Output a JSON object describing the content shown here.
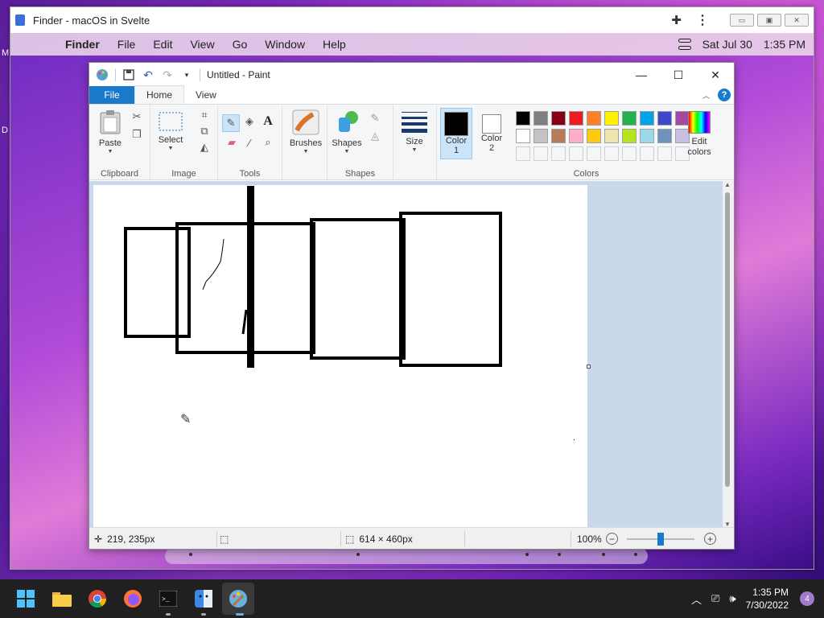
{
  "browser": {
    "tab_title": "Finder - macOS in Svelte",
    "extensions_icon": "puzzle-icon",
    "menu_icon": "kebab-icon"
  },
  "mac": {
    "apple_icon": "apple-logo-icon",
    "app_name": "Finder",
    "menus": [
      "File",
      "Edit",
      "View",
      "Go",
      "Window",
      "Help"
    ],
    "date": "Sat Jul 30",
    "time": "1:35 PM"
  },
  "paint": {
    "title": "Untitled - Paint",
    "tabs": {
      "file": "File",
      "home": "Home",
      "view": "View"
    },
    "groups": {
      "clipboard": "Clipboard",
      "image": "Image",
      "tools": "Tools",
      "shapes": "Shapes",
      "colors": "Colors"
    },
    "buttons": {
      "paste": "Paste",
      "select": "Select",
      "brushes": "Brushes",
      "shapes": "Shapes",
      "size": "Size",
      "color1": "Color\n1",
      "color1_a": "Color",
      "color1_b": "1",
      "color2_a": "Color",
      "color2_b": "2",
      "edit_colors_a": "Edit",
      "edit_colors_b": "colors"
    },
    "palette_row1": [
      "#000000",
      "#7f7f7f",
      "#880015",
      "#ed1c24",
      "#ff7f27",
      "#fff200",
      "#22b14c",
      "#00a2e8",
      "#3f48cc",
      "#a349a4"
    ],
    "palette_row2": [
      "#ffffff",
      "#c3c3c3",
      "#b97a57",
      "#ffaec9",
      "#ffc90e",
      "#efe4b0",
      "#b5e61d",
      "#99d9ea",
      "#7092be",
      "#c8bfe7"
    ],
    "color1_value": "#000000",
    "color2_value": "#ffffff",
    "status": {
      "cursor_pos": "219, 235px",
      "canvas_size": "614 × 460px",
      "zoom": "100%"
    }
  },
  "taskbar": {
    "time": "1:35 PM",
    "date": "7/30/2022",
    "notifications": "4",
    "apps": [
      "start-icon",
      "file-explorer-icon",
      "chrome-icon",
      "firefox-icon",
      "terminal-icon",
      "finder-icon",
      "paint-icon"
    ]
  },
  "side_letters": [
    "M",
    "D"
  ]
}
